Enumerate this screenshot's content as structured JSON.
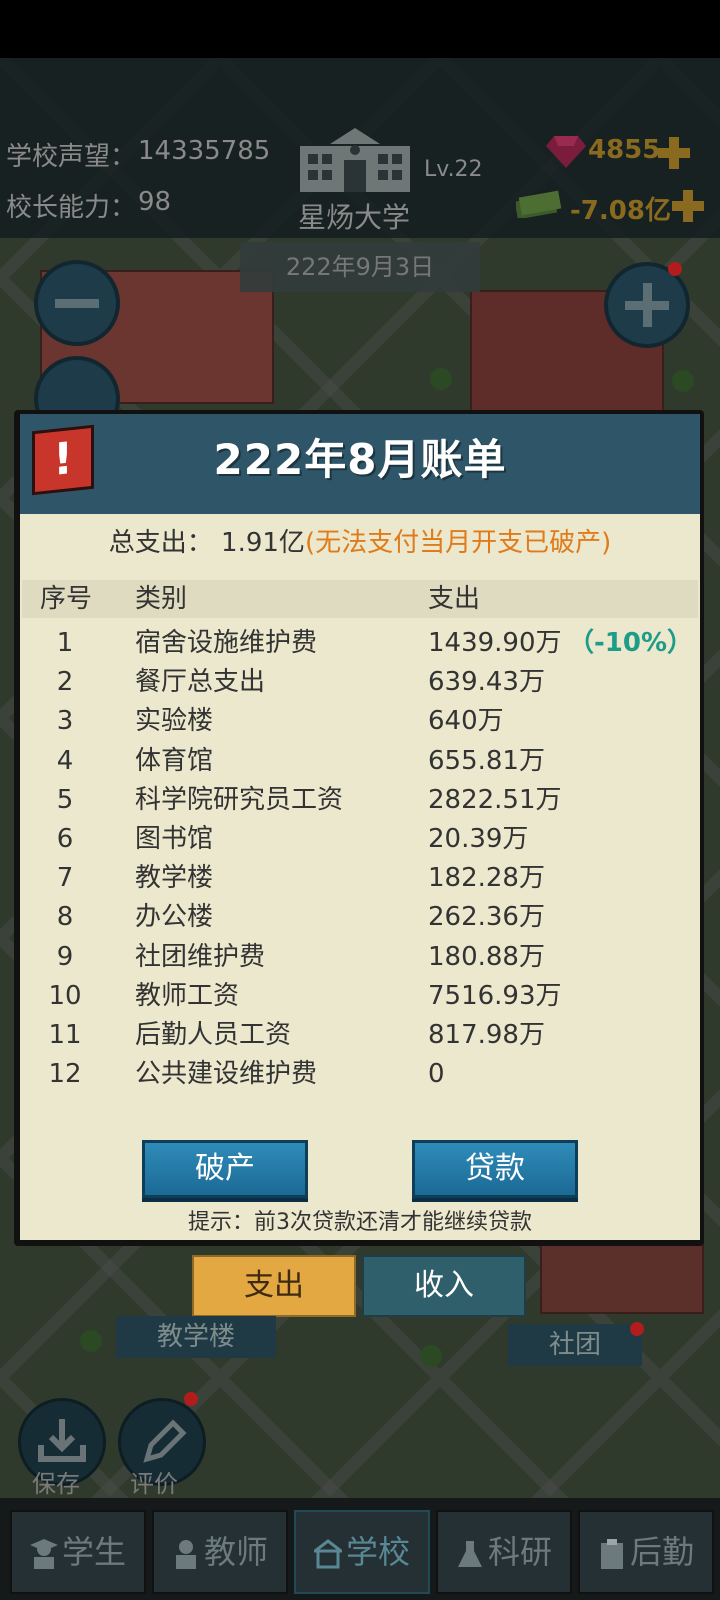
{
  "hud": {
    "reputation_label": "学校声望：",
    "reputation_value": "14335785",
    "ability_label": "校长能力：",
    "ability_value": "98",
    "school_name": "星炀大学",
    "level": "Lv.22",
    "gems": "4855",
    "money": "-7.08亿",
    "date": "222年9月3日"
  },
  "dialog": {
    "title": "222年8月账单",
    "alert_icon": "!",
    "total_label": "总支出：",
    "total_value": "1.91亿",
    "total_warning": "(无法支付当月开支已破产)",
    "headers": {
      "index": "序号",
      "category": "类别",
      "expense": "支出"
    },
    "rows": [
      {
        "index": "1",
        "category": "宿舍设施维护费",
        "amount": "1439.90万",
        "note": "（-10%）"
      },
      {
        "index": "2",
        "category": "餐厅总支出",
        "amount": "639.43万"
      },
      {
        "index": "3",
        "category": "实验楼",
        "amount": "640万"
      },
      {
        "index": "4",
        "category": "体育馆",
        "amount": "655.81万"
      },
      {
        "index": "5",
        "category": "科学院研究员工资",
        "amount": "2822.51万"
      },
      {
        "index": "6",
        "category": "图书馆",
        "amount": "20.39万"
      },
      {
        "index": "7",
        "category": "教学楼",
        "amount": "182.28万"
      },
      {
        "index": "8",
        "category": "办公楼",
        "amount": "262.36万"
      },
      {
        "index": "9",
        "category": "社团维护费",
        "amount": "180.88万"
      },
      {
        "index": "10",
        "category": "教师工资",
        "amount": "7516.93万"
      },
      {
        "index": "11",
        "category": "后勤人员工资",
        "amount": "817.98万"
      },
      {
        "index": "12",
        "category": "公共建设维护费",
        "amount": "0"
      }
    ],
    "bankrupt_button": "破产",
    "loan_button": "贷款",
    "hint": "提示：前3次贷款还清才能继续贷款",
    "tab_expense": "支出",
    "tab_income": "收入"
  },
  "map": {
    "label_teaching": "教学楼",
    "label_club": "社团",
    "save_label": "保存",
    "review_label": "评价"
  },
  "nav": {
    "items": [
      {
        "label": "学生",
        "icon": "student-icon"
      },
      {
        "label": "教师",
        "icon": "teacher-icon"
      },
      {
        "label": "学校",
        "icon": "school-icon"
      },
      {
        "label": "科研",
        "icon": "flask-icon"
      },
      {
        "label": "后勤",
        "icon": "clipboard-icon"
      }
    ],
    "active": "学校"
  },
  "colors": {
    "warning": "#e07b1c",
    "positive": "#1d9c88",
    "dialog_header": "#2e5668",
    "dialog_body": "#ebe8ce",
    "expense_tab": "#e4a842"
  }
}
